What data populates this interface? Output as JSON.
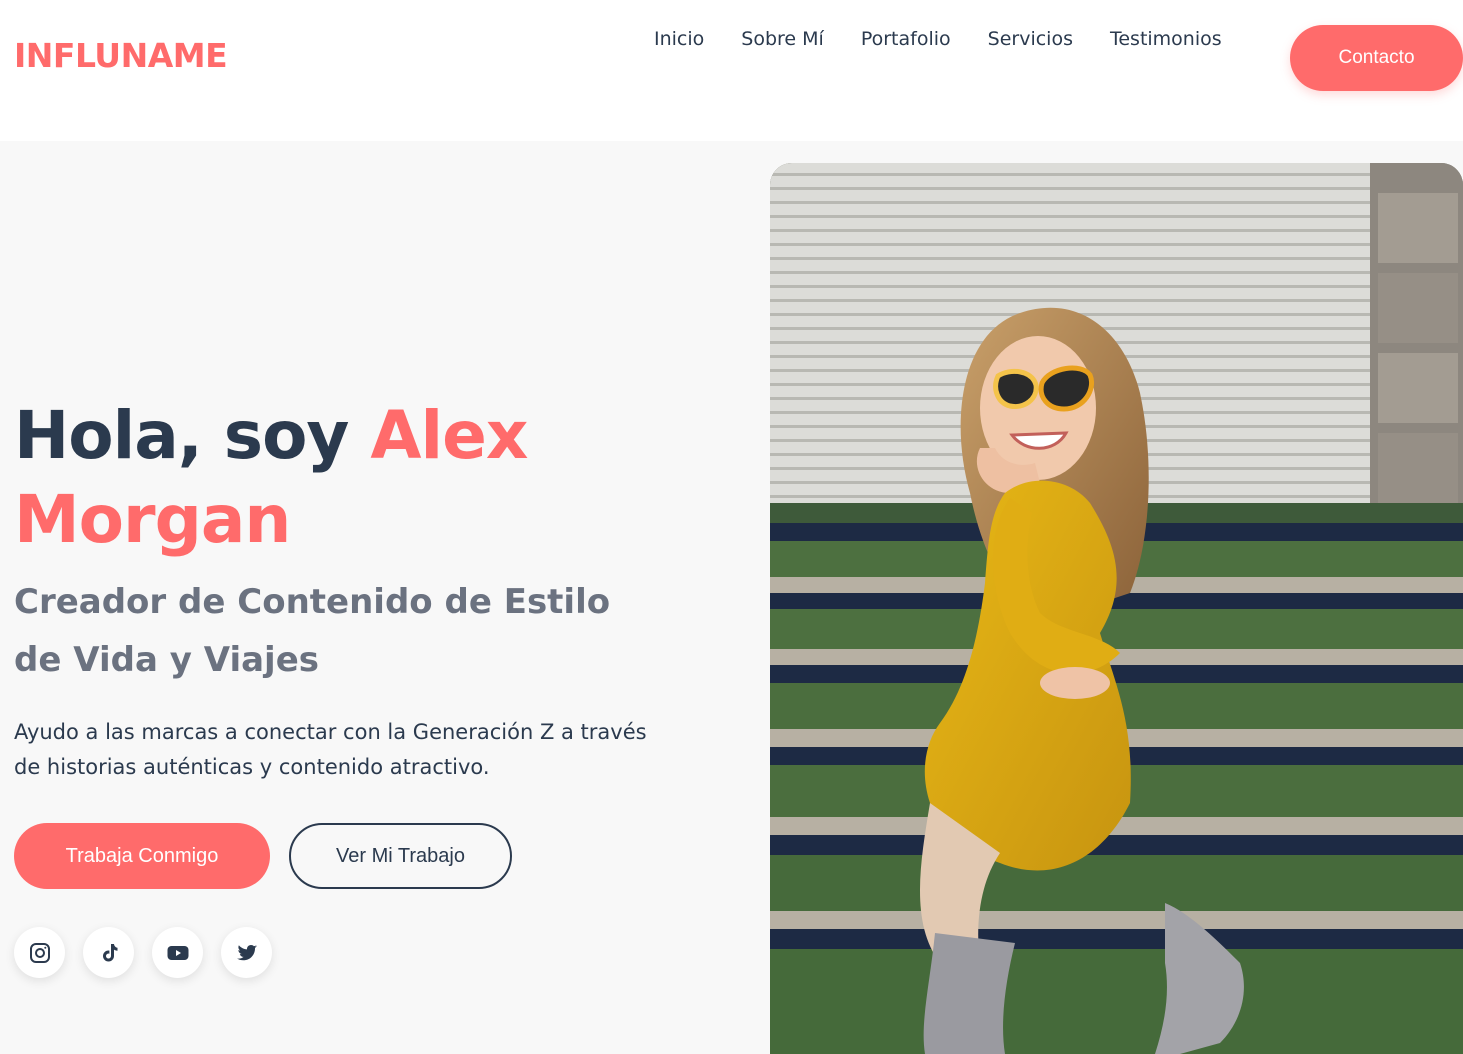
{
  "header": {
    "logo": "INFLUNAME",
    "nav": [
      "Inicio",
      "Sobre Mí",
      "Portafolio",
      "Servicios",
      "Testimonios"
    ],
    "contact_label": "Contacto"
  },
  "hero": {
    "title_prefix": "Hola, soy ",
    "title_name": "Alex Morgan",
    "subtitle": "Creador de Contenido de Estilo de Vida y Viajes",
    "description": "Ayudo a las marcas a conectar con la Generación Z a través de historias auténticas y contenido atractivo.",
    "primary_cta": "Trabaja Conmigo",
    "secondary_cta": "Ver Mi Trabajo",
    "socials": [
      "instagram-icon",
      "tiktok-icon",
      "youtube-icon",
      "twitter-icon"
    ]
  },
  "colors": {
    "accent": "#ff6b6b",
    "dark": "#2b3a4e",
    "muted": "#6b7280"
  }
}
